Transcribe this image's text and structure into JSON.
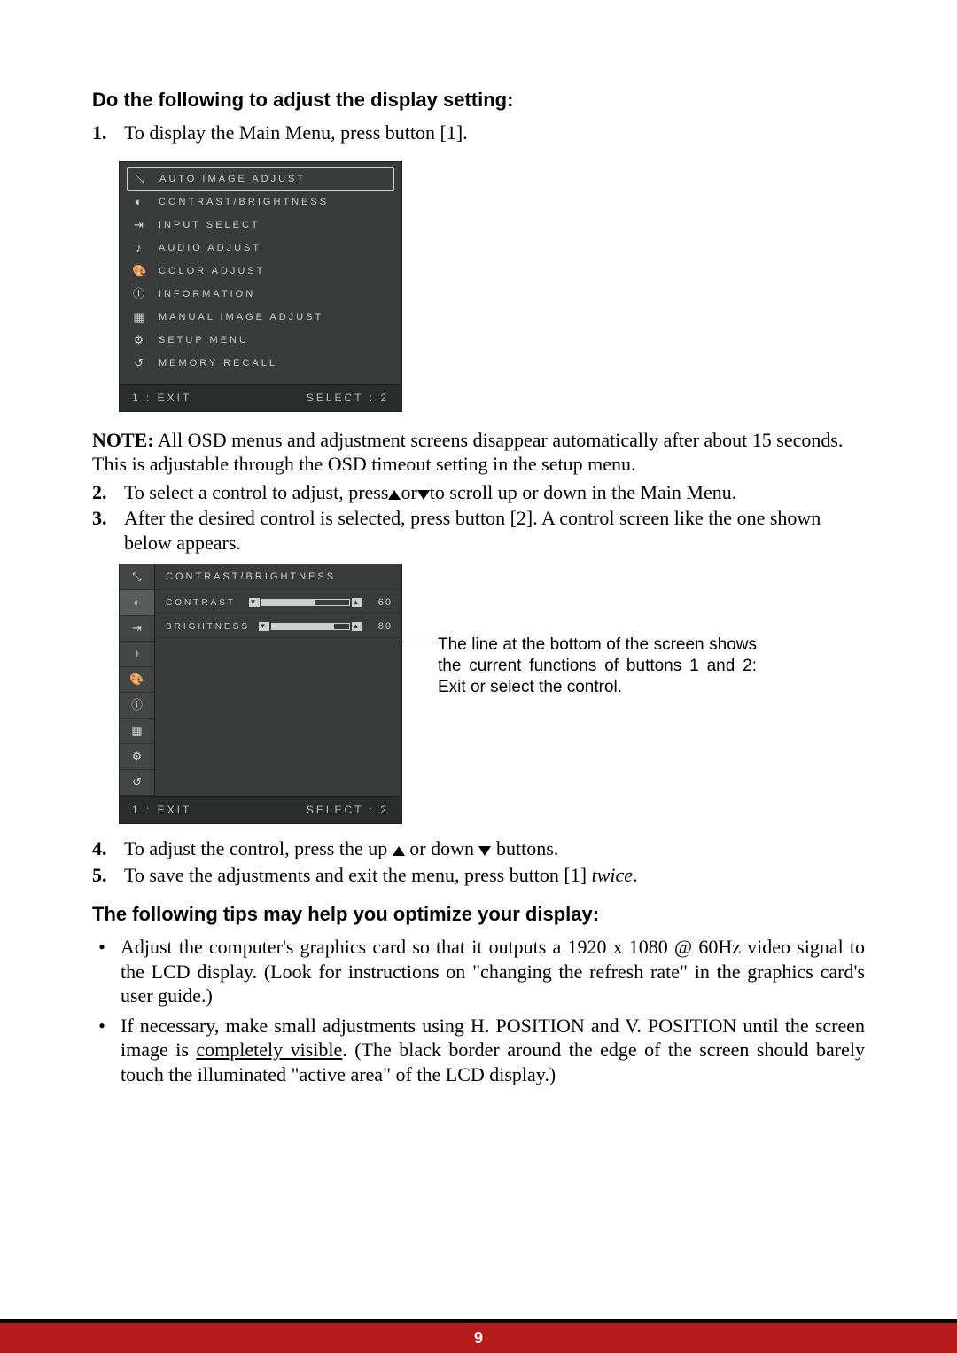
{
  "heading1": "Do the following to adjust the display setting:",
  "step1_num": "1.",
  "step1": "To display the Main Menu, press button [1].",
  "osd1": {
    "items": [
      {
        "icon": "auto-image-adjust-icon",
        "label": "AUTO IMAGE ADJUST",
        "selected": true
      },
      {
        "icon": "contrast-brightness-icon",
        "label": "CONTRAST/BRIGHTNESS"
      },
      {
        "icon": "input-select-icon",
        "label": "INPUT SELECT"
      },
      {
        "icon": "audio-adjust-icon",
        "label": "AUDIO ADJUST"
      },
      {
        "icon": "color-adjust-icon",
        "label": "COLOR ADJUST"
      },
      {
        "icon": "information-icon",
        "label": "INFORMATION"
      },
      {
        "icon": "manual-image-adjust-icon",
        "label": "MANUAL IMAGE ADJUST"
      },
      {
        "icon": "setup-menu-icon",
        "label": "SETUP MENU"
      },
      {
        "icon": "memory-recall-icon",
        "label": "MEMORY RECALL"
      }
    ],
    "foot_left": "1 : EXIT",
    "foot_right": "SELECT : 2"
  },
  "note_label": "NOTE:",
  "note_text": " All OSD menus and adjustment screens disappear automatically after about 15 seconds. This is adjustable through the OSD timeout setting in the setup menu.",
  "step2_num": "2.",
  "step2_a": "To select a control to adjust, press",
  "step2_b": "or",
  "step2_c": "to scroll up or down in the Main Menu.",
  "step3_num": "3.",
  "step3": "After the desired control is selected, press button [2]. A control screen like the one shown below appears.",
  "osd2": {
    "title": "CONTRAST/BRIGHTNESS",
    "controls": [
      {
        "label": "CONTRAST",
        "value": 60,
        "fill_pct": 60
      },
      {
        "label": "BRIGHTNESS",
        "value": 80,
        "fill_pct": 80
      }
    ],
    "foot_left": "1 : EXIT",
    "foot_right": "SELECT : 2"
  },
  "callout": "The line at the bottom of the screen shows the current functions of buttons 1 and 2: Exit or select the control.",
  "step4_num": "4.",
  "step4_a": "To adjust the control, press the up ",
  "step4_b": " or down ",
  "step4_c": " buttons.",
  "step5_num": "5.",
  "step5_a": "To save the adjustments and exit the menu, press button [1] ",
  "step5_italic": "twice",
  "step5_b": ".",
  "heading2": "The following tips may help you optimize your display:",
  "tip1": "Adjust the computer's graphics card so that it outputs a 1920 x 1080 @ 60Hz video signal to the LCD display. (Look for instructions on \"changing the refresh rate\" in the graphics card's user guide.)",
  "tip2_a": "If necessary, make small adjustments using H. POSITION and V. POSITION until the screen image is ",
  "tip2_u": "completely visible",
  "tip2_b": ". (The black border around the edge of the screen should barely touch the illuminated \"active area\" of the LCD display.)",
  "page_number": "9",
  "icon_glyphs": {
    "auto-image-adjust-icon": "⤡",
    "contrast-brightness-icon": "◐",
    "input-select-icon": "⇥",
    "audio-adjust-icon": "♪",
    "color-adjust-icon": "🎨",
    "information-icon": "ⓘ",
    "manual-image-adjust-icon": "▦",
    "setup-menu-icon": "⚙",
    "memory-recall-icon": "↺"
  }
}
